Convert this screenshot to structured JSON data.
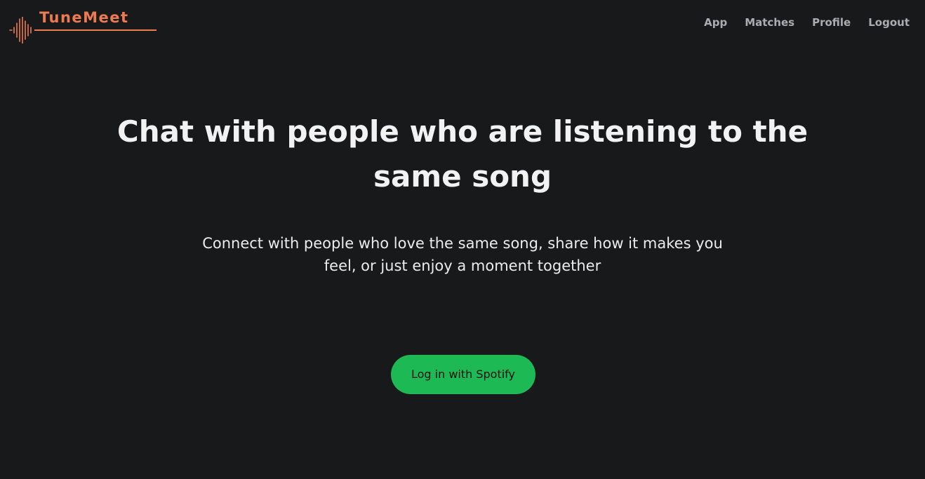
{
  "brand": {
    "name": "TuneMeet",
    "accent_color": "#ee7a4f",
    "logo_icon": "soundwave-icon"
  },
  "nav": {
    "items": [
      {
        "label": "App"
      },
      {
        "label": "Matches"
      },
      {
        "label": "Profile"
      },
      {
        "label": "Logout"
      }
    ]
  },
  "hero": {
    "title_line1": "Chat with people who are listening to the",
    "title_line2": "same song",
    "subtitle_line1": "Connect with people who love the same song, share how it makes you",
    "subtitle_line2": "feel, or just enjoy a moment together"
  },
  "cta": {
    "label": "Log in with Spotify",
    "color": "#1db954"
  },
  "colors": {
    "background": "#18191b",
    "nav_text": "#a9adb3",
    "heading_text": "#f2f2f2"
  }
}
